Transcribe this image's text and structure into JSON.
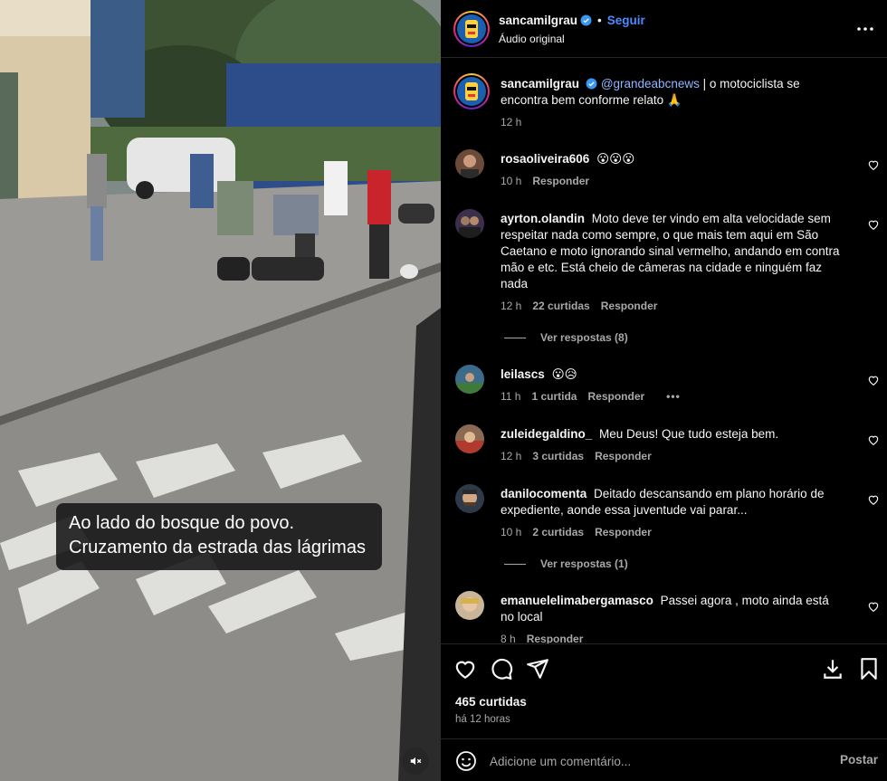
{
  "video": {
    "caption_line1": "Ao lado do bosque do povo.",
    "caption_line2": "Cruzamento da estrada das lágrimas",
    "mute_icon": "speaker-muted-icon"
  },
  "header": {
    "username": "sancamilgrau",
    "separator": "•",
    "follow_label": "Seguir",
    "audio_label": "Áudio original",
    "more_icon": "more-options-icon"
  },
  "caption_comment": {
    "username": "sancamilgrau",
    "mention": "@grandeabcnews",
    "text": " | o motociclista se encontra bem conforme relato 🙏",
    "time": "12 h"
  },
  "comments": [
    {
      "username": "rosaoliveira606",
      "text": "😮😮😮",
      "time": "10 h",
      "likes": "",
      "reply": "Responder"
    },
    {
      "username": "ayrton.olandin",
      "text": "Moto deve ter vindo em alta velocidade sem respeitar nada como sempre, o que mais tem aqui em São Caetano e moto ignorando sinal vermelho, andando em contra mão e etc. Está cheio de câmeras na cidade e ninguém faz nada",
      "time": "12 h",
      "likes": "22 curtidas",
      "reply": "Responder",
      "view_replies": "Ver respostas (8)"
    },
    {
      "username": "leilascs",
      "text": "😮😥",
      "time": "11 h",
      "likes": "1 curtida",
      "reply": "Responder",
      "more": "•••"
    },
    {
      "username": "zuleidegaldino_",
      "text": "Meu Deus! Que tudo esteja bem.",
      "time": "12 h",
      "likes": "3 curtidas",
      "reply": "Responder"
    },
    {
      "username": "danilocomenta",
      "text": "Deitado descansando em plano horário de expediente, aonde essa juventude vai parar...",
      "time": "10 h",
      "likes": "2 curtidas",
      "reply": "Responder",
      "view_replies": "Ver respostas (1)"
    },
    {
      "username": "emanuelelimabergamasco",
      "text": "Passei agora , moto ainda está no local",
      "time": "8 h",
      "likes": "",
      "reply": "Responder"
    }
  ],
  "actions": {
    "likes": "465 curtidas",
    "time_ago": "há 12 horas",
    "comment_placeholder": "Adicione um comentário...",
    "post_label": "Postar"
  },
  "colors": {
    "background": "#000000",
    "text": "#f5f5f5",
    "muted": "#a8a8a8",
    "follow": "#4a8cff",
    "mention": "#8fb6ff",
    "verified": "#3897f0"
  }
}
